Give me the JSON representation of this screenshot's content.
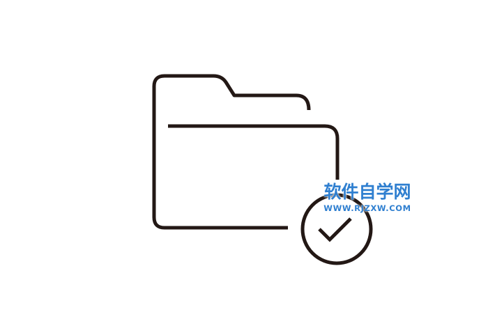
{
  "icon": {
    "name": "folder-check-icon",
    "stroke_color": "#231815",
    "background_color": "#ffffff"
  },
  "watermark": {
    "title": "软件自学网",
    "url": "WWW.RJZXW.COM",
    "color": "#2f7fd0"
  }
}
